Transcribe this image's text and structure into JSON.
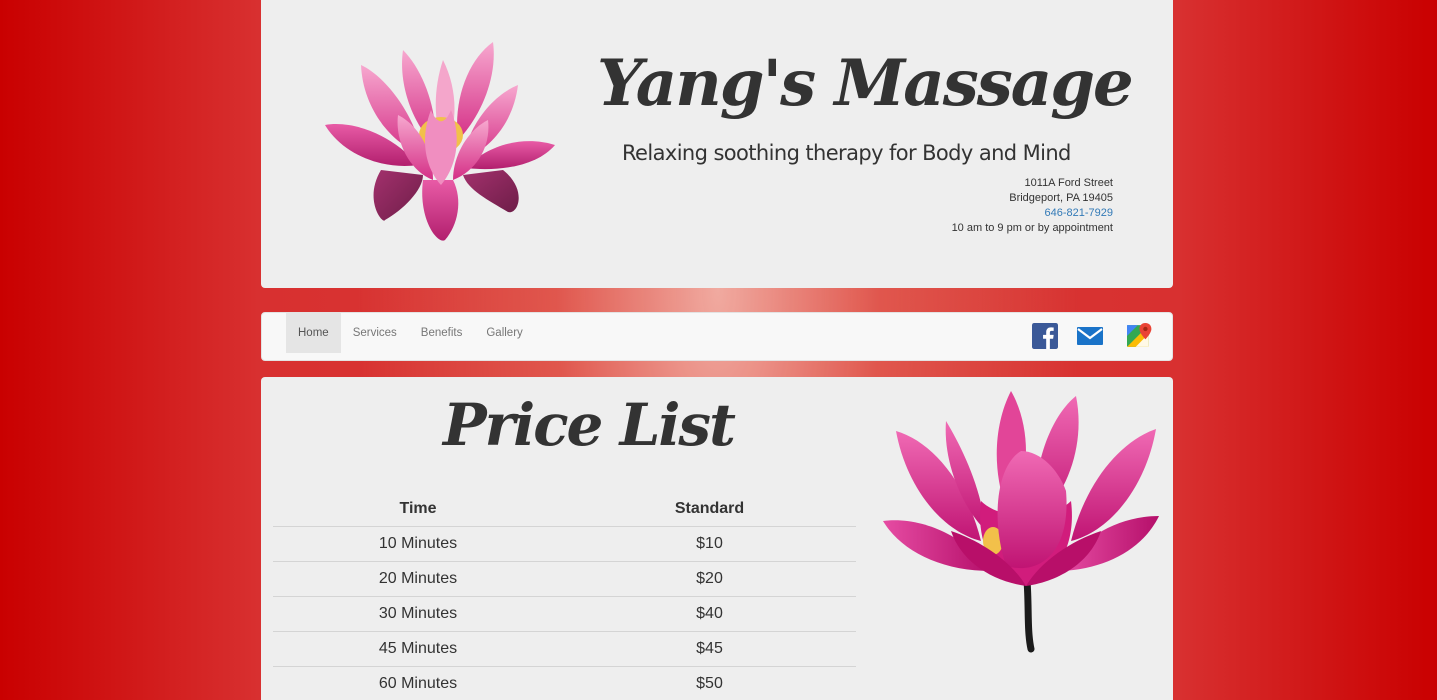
{
  "header": {
    "title": "Yang's Massage",
    "tagline": "Relaxing soothing therapy for Body and Mind",
    "address_line1": "1011A Ford Street",
    "address_line2": "Bridgeport, PA 19405",
    "phone": "646-821-7929",
    "hours": "10 am to 9 pm or by appointment"
  },
  "nav": {
    "items": [
      {
        "label": "Home",
        "active": true
      },
      {
        "label": "Services",
        "active": false
      },
      {
        "label": "Benefits",
        "active": false
      },
      {
        "label": "Gallery",
        "active": false
      }
    ],
    "social": [
      {
        "icon": "facebook-icon",
        "color": "#3b5998"
      },
      {
        "icon": "mail-icon",
        "color": "#1a73c8"
      },
      {
        "icon": "google-maps-icon",
        "color": "#34a853"
      }
    ]
  },
  "prices": {
    "title": "Price List",
    "columns": [
      "Time",
      "Standard"
    ],
    "rows": [
      [
        "10 Minutes",
        "$10"
      ],
      [
        "20 Minutes",
        "$20"
      ],
      [
        "30 Minutes",
        "$40"
      ],
      [
        "45 Minutes",
        "$45"
      ],
      [
        "60 Minutes",
        "$50"
      ]
    ]
  },
  "colors": {
    "background_red": "#c90000",
    "panel": "#eeeeee",
    "link": "#337ab7",
    "lotus_pink": "#e2338f"
  }
}
